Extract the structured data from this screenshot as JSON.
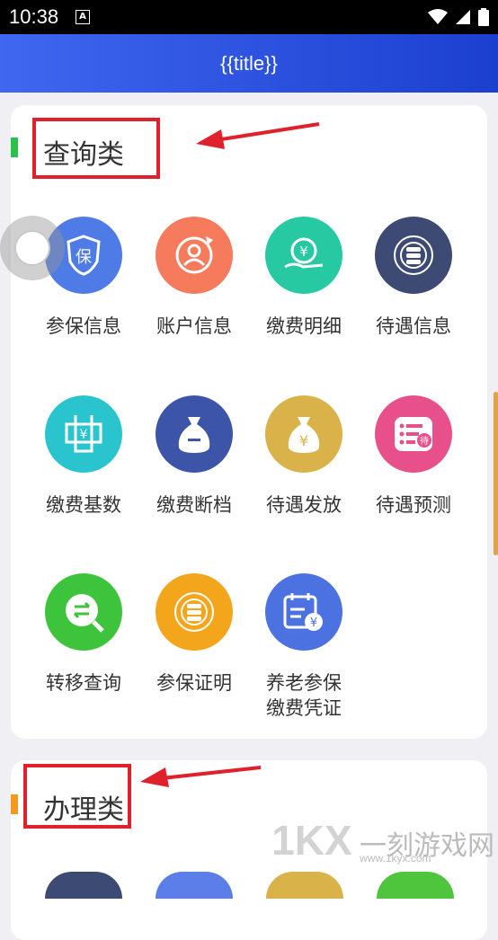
{
  "status_bar": {
    "time": "10:38",
    "notif_glyph": "A"
  },
  "header": {
    "title": "{{title}}"
  },
  "sections": [
    {
      "title": "查询类",
      "bar_color": "#2bc24a"
    },
    {
      "title": "办理类",
      "bar_color": "#f29a1f"
    }
  ],
  "query_items": [
    {
      "label": "参保信息",
      "color": "#4e7be6",
      "icon": "shield-icon"
    },
    {
      "label": "账户信息",
      "color": "#f57b5c",
      "icon": "user-refresh-icon"
    },
    {
      "label": "缴费明细",
      "color": "#27c9a2",
      "icon": "yuan-hand-icon"
    },
    {
      "label": "待遇信息",
      "color": "#3d4a73",
      "icon": "coin-stack-icon"
    },
    {
      "label": "缴费基数",
      "color": "#2ac4cf",
      "icon": "hand-yuan-icon"
    },
    {
      "label": "缴费断档",
      "color": "#3d55a8",
      "icon": "money-bag-minus-icon"
    },
    {
      "label": "待遇发放",
      "color": "#d9b24a",
      "icon": "money-bag-yuan-icon"
    },
    {
      "label": "待遇预测",
      "color": "#e8508c",
      "icon": "list-forecast-icon"
    },
    {
      "label": "转移查询",
      "color": "#3ec43c",
      "icon": "transfer-search-icon"
    },
    {
      "label": "参保证明",
      "color": "#f3a51b",
      "icon": "coin-stack-icon"
    },
    {
      "label": "养老参保\n缴费凭证",
      "label_line1": "养老参保",
      "label_line2": "缴费凭证",
      "color": "#4b72e0",
      "icon": "calendar-yuan-icon"
    }
  ],
  "watermark": {
    "brand": "1KX",
    "text": "一刻游戏网",
    "url": "www.1kyx.com"
  }
}
